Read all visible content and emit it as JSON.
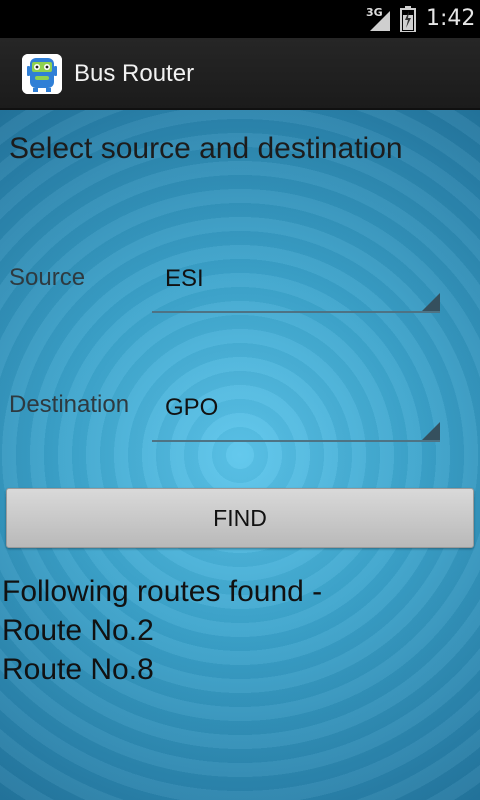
{
  "status_bar": {
    "network": "3G",
    "time": "1:42",
    "icons": [
      "signal-icon",
      "battery-icon"
    ]
  },
  "action_bar": {
    "app_icon": "bus-robot-app-icon",
    "title": "Bus Router"
  },
  "main": {
    "heading": "Select source and destination",
    "source": {
      "label": "Source",
      "value": "ESI"
    },
    "destination": {
      "label": "Destination",
      "value": "GPO"
    },
    "find_button": "FIND",
    "results": {
      "header": "Following routes found -",
      "routes": [
        "Route No.2",
        "Route No.8"
      ]
    }
  },
  "colors": {
    "background_center": "#5cc6ec",
    "background_edge": "#1e6a92",
    "action_bar": "#262626"
  }
}
